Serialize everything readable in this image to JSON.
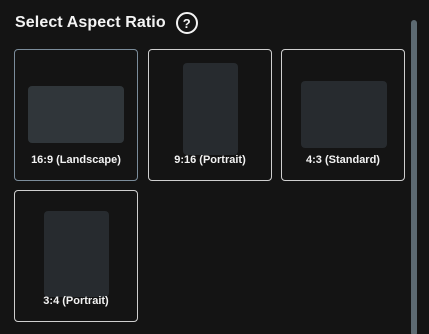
{
  "header": {
    "title": "Select Aspect Ratio",
    "help_icon": "?"
  },
  "options": [
    {
      "label": "16:9 (Landscape)",
      "selected": true
    },
    {
      "label": "9:16 (Portrait)",
      "selected": false
    },
    {
      "label": "4:3 (Standard)",
      "selected": false
    },
    {
      "label": "3:4 (Portrait)",
      "selected": false
    }
  ]
}
